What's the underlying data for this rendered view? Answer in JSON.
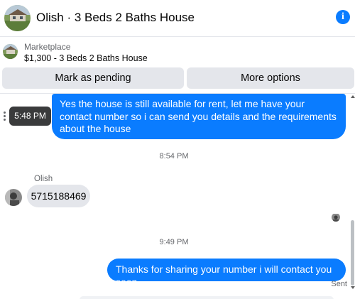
{
  "header": {
    "title": "Olish · 3 Beds 2 Baths House",
    "avatar_icon": "house-photo-icon",
    "info_glyph": "i",
    "info_icon": "info-icon",
    "accent_color": "#0a7cff"
  },
  "listing": {
    "kicker": "Marketplace",
    "price_title": "$1,300 - 3 Beds 2 Baths House",
    "thumb_icon": "house-thumbnail-icon"
  },
  "actions": {
    "mark_pending": "Mark as pending",
    "more_options": "More options"
  },
  "thread": {
    "outgoing_1": "Yes the house is still available for rent, let me have your contact number so i can send you details and the requirements about the house",
    "tooltip_time": "5:48 PM",
    "timestamp_1": "8:54 PM",
    "sender_name": "Olish",
    "incoming_1": "5715188469",
    "timestamp_2": "9:49 PM",
    "outgoing_2": "Thanks for sharing your number i will contact you soon.",
    "status": "Sent",
    "outgoing_color": "#0a7cff",
    "incoming_color": "#e4e6eb"
  }
}
